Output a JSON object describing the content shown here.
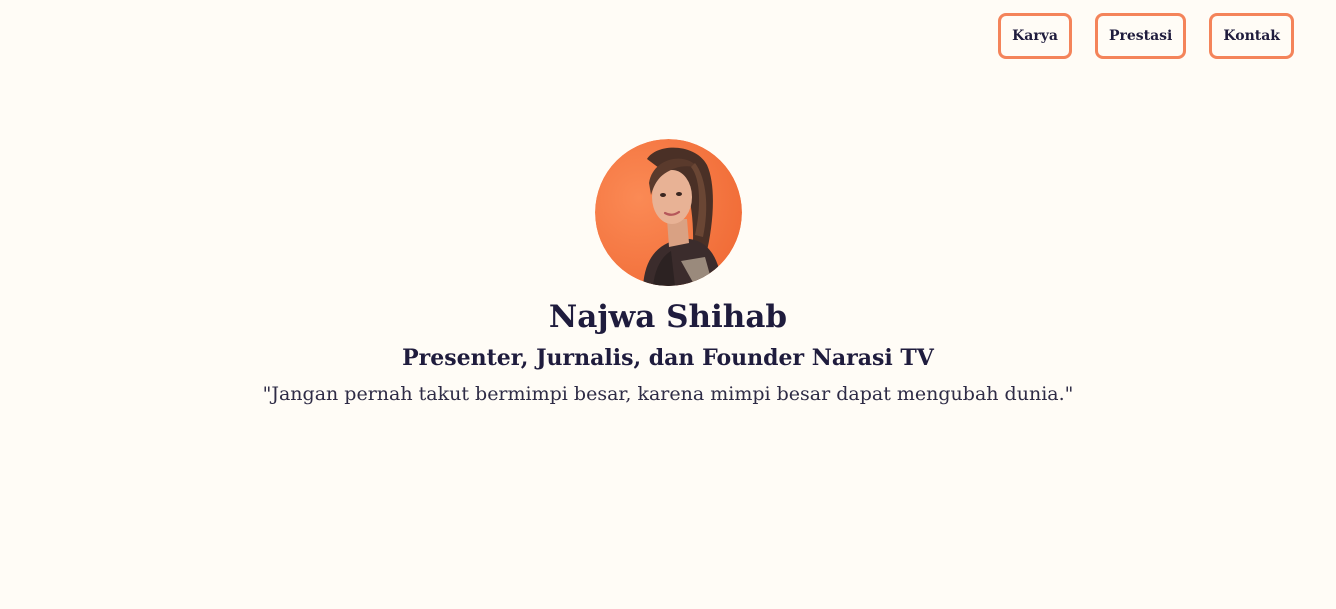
{
  "nav": {
    "items": [
      {
        "label": "Karya"
      },
      {
        "label": "Prestasi"
      },
      {
        "label": "Kontak"
      }
    ]
  },
  "profile": {
    "name": "Najwa Shihab",
    "role": "Presenter, Jurnalis, dan Founder Narasi TV",
    "quote": "\"Jangan pernah takut bermimpi besar, karena mimpi besar dapat mengubah dunia.\""
  },
  "colors": {
    "background": "#fffcf6",
    "accent": "#f4845a",
    "text": "#1f1c3d"
  }
}
